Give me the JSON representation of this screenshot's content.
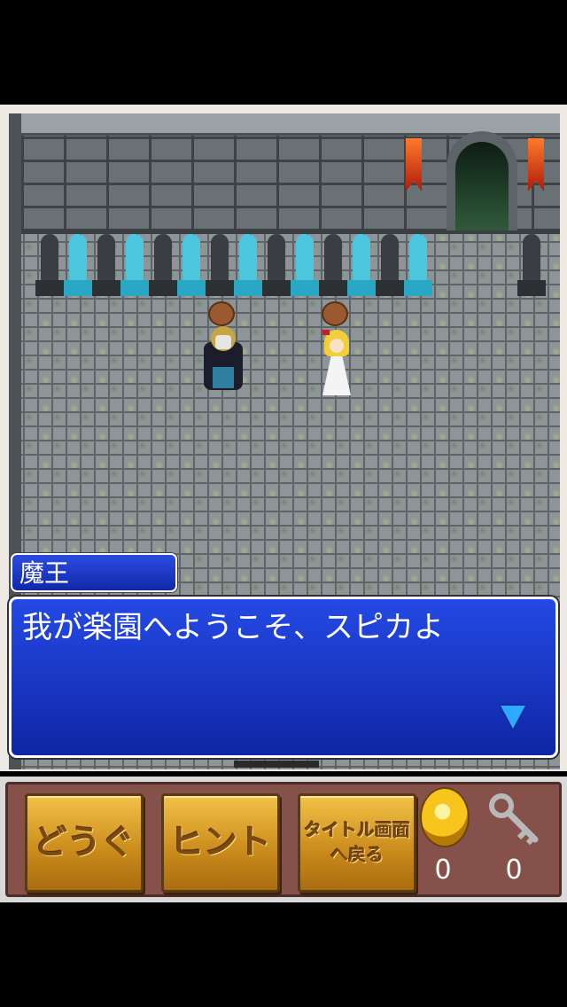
{
  "dialog": {
    "speaker": "魔王",
    "message": "我が楽園へようこそ、スピカよ",
    "advance_icon": "down-triangle-icon",
    "accent_color": "#1f45d8"
  },
  "menu": {
    "items_label": "どうぐ",
    "hint_label": "ヒント",
    "title_label": "タイトル画面\nへ戻る"
  },
  "status": {
    "coin_icon": "gold-coin-icon",
    "coin_count": "0",
    "key_icon": "key-icon",
    "key_count": "0"
  }
}
